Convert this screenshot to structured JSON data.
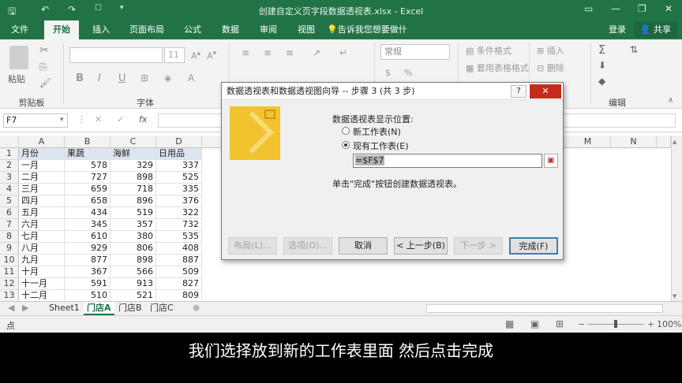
{
  "app": {
    "title": "创建自定义页字段数据透视表.xlsx - Excel"
  },
  "tabs": [
    {
      "label": "文件"
    },
    {
      "label": "开始"
    },
    {
      "label": "插入"
    },
    {
      "label": "页面布局"
    },
    {
      "label": "公式"
    },
    {
      "label": "数据"
    },
    {
      "label": "审阅"
    },
    {
      "label": "视图"
    }
  ],
  "tell_me": "告诉我您想要做什么...",
  "login": "登录",
  "share": "共享",
  "ribbon": {
    "paste_label": "粘贴",
    "clipboard_label": "剪贴板",
    "font_label": "字体",
    "font_size": "11",
    "number_format": "常规",
    "conditional_format": "条件格式",
    "table_format": "套用表格格式",
    "insert": "插入",
    "delete": "删除",
    "edit_label": "编辑",
    "bold": "B",
    "italic": "I",
    "underline": "U"
  },
  "formula_bar": {
    "name_box": "F7",
    "fx": "fx"
  },
  "sheet": {
    "columns": [
      "A",
      "B",
      "C",
      "D",
      "M",
      "N"
    ],
    "header_row": [
      "月份",
      "果蔬",
      "海鲜",
      "日用品"
    ],
    "rows": [
      {
        "n": "2",
        "month": "一月",
        "b": "578",
        "c": "329",
        "d": "337"
      },
      {
        "n": "3",
        "month": "二月",
        "b": "727",
        "c": "898",
        "d": "525"
      },
      {
        "n": "4",
        "month": "三月",
        "b": "659",
        "c": "718",
        "d": "335"
      },
      {
        "n": "5",
        "month": "四月",
        "b": "658",
        "c": "896",
        "d": "376"
      },
      {
        "n": "6",
        "month": "五月",
        "b": "434",
        "c": "519",
        "d": "322"
      },
      {
        "n": "7",
        "month": "六月",
        "b": "345",
        "c": "357",
        "d": "732"
      },
      {
        "n": "8",
        "month": "七月",
        "b": "610",
        "c": "380",
        "d": "535"
      },
      {
        "n": "9",
        "month": "八月",
        "b": "929",
        "c": "806",
        "d": "408"
      },
      {
        "n": "10",
        "month": "九月",
        "b": "877",
        "c": "898",
        "d": "887"
      },
      {
        "n": "11",
        "month": "十月",
        "b": "367",
        "c": "566",
        "d": "509"
      },
      {
        "n": "12",
        "month": "十一月",
        "b": "591",
        "c": "913",
        "d": "827"
      },
      {
        "n": "13",
        "month": "十二月",
        "b": "510",
        "c": "521",
        "d": "809"
      }
    ],
    "first_row_number": "1",
    "sheet_tabs": [
      "Sheet1",
      "门店A",
      "门店B",
      "门店C"
    ],
    "status": "点",
    "zoom": "100%"
  },
  "dialog": {
    "title": "数据透视表和数据透视图向导 -- 步骤 3 (共 3 步)",
    "help": "?",
    "prompt": "数据透视表显示位置:",
    "option_new": "新工作表(N)",
    "option_existing": "现有工作表(E)",
    "range_value": "=$F$7",
    "hint": "单击\"完成\"按钮创建数据透视表。",
    "btn_layout": "布局(L)...",
    "btn_options": "选项(O)...",
    "btn_cancel": "取消",
    "btn_back": "< 上一步(B)",
    "btn_next": "下一步 >",
    "btn_finish": "完成(F)"
  },
  "subtitle": "我们选择放到新的工作表里面 然后点击完成",
  "colors": {
    "excel_green": "#217346",
    "header_blue": "#dce6f1"
  }
}
